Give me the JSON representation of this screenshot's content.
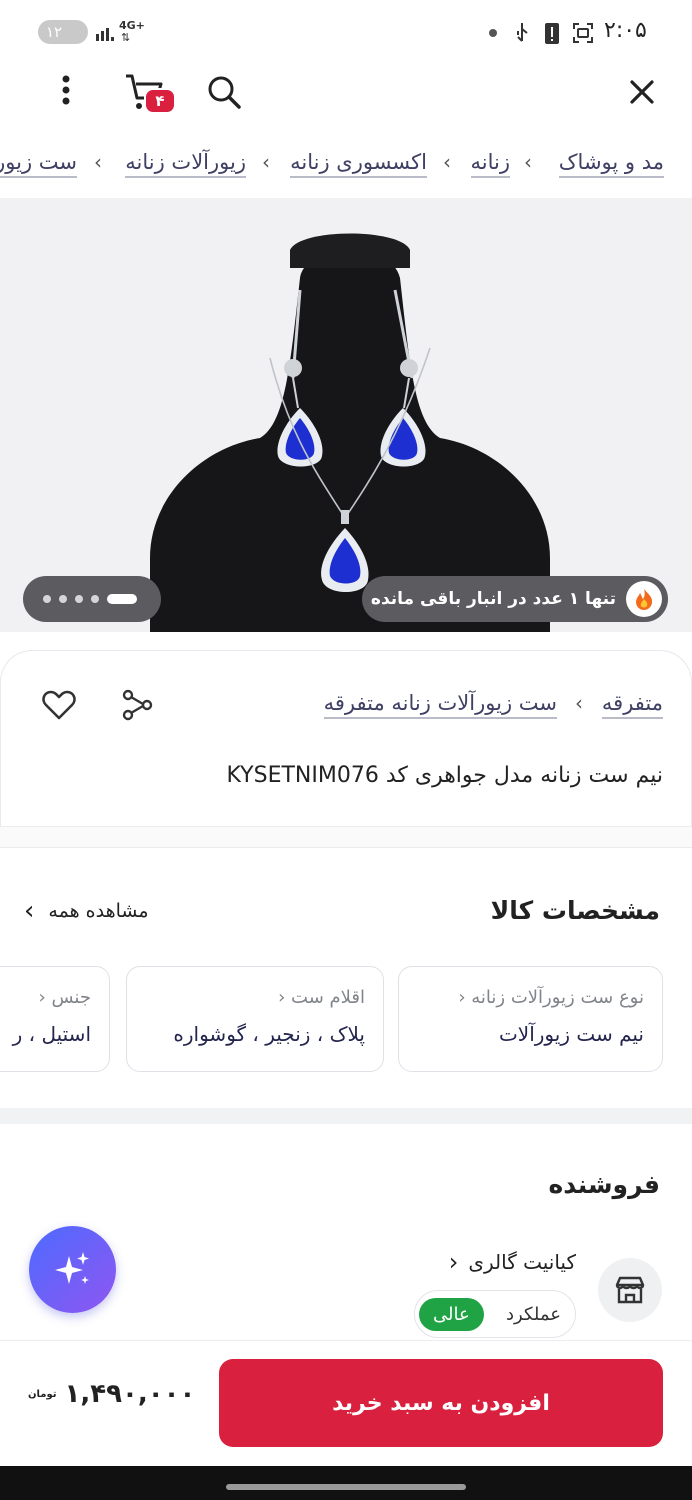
{
  "status": {
    "time": "۲:۰۵",
    "badge": "۱۲",
    "network": "4G+"
  },
  "header": {
    "cart_count": "۴"
  },
  "breadcrumb": [
    "مد و پوشاک",
    "زنانه",
    "اکسسوری زنانه",
    "زیورآلات زنانه",
    "ست زیورآلات"
  ],
  "gallery": {
    "stock_notice": "تنها ۱ عدد در انبار باقی مانده"
  },
  "product": {
    "category": "متفرقه",
    "subcategory": "ست زیورآلات زنانه متفرقه",
    "title": "نیم ست زنانه مدل جواهری کد KYSETNIM076"
  },
  "specs": {
    "heading": "مشخصات کالا",
    "view_all": "مشاهده همه",
    "items": [
      {
        "key": "نوع ست زیورآلات زنانه",
        "value": "نیم ست زیورآلات"
      },
      {
        "key": "اقلام ست",
        "value": "پلاک ، زنجیر ، گوشواره"
      },
      {
        "key": "جنس",
        "value": "استیل ، ر"
      }
    ]
  },
  "seller": {
    "heading": "فروشنده",
    "name": "کیانیت گالری",
    "performance_label": "عملکرد",
    "performance_value": "عالی"
  },
  "buy": {
    "add_to_cart": "افزودن به سبد خرید",
    "price": "۱,۴۹۰,۰۰۰",
    "currency": "تومان"
  },
  "colors": {
    "accent": "#d9203f",
    "badge_green": "#1fa345",
    "assistant_from": "#4d6bff",
    "assistant_to": "#8f56f0"
  }
}
